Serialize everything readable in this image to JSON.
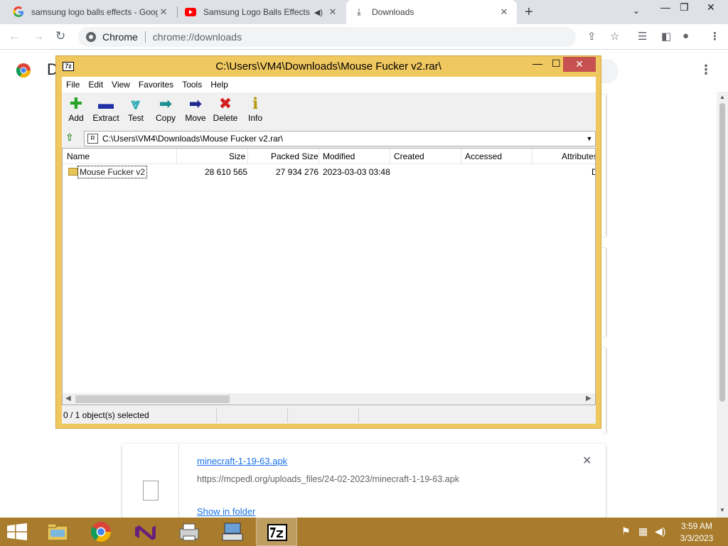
{
  "tabs": [
    {
      "title": "samsung logo balls effects - Google",
      "close": "✕"
    },
    {
      "title": "Samsung Logo Balls Effects (Inspire",
      "close": "✕"
    },
    {
      "title": "Downloads",
      "close": "✕"
    }
  ],
  "browser": {
    "new_tab": "+",
    "minimize": "—",
    "restore": "❐",
    "close": "✕",
    "back": "←",
    "forward": "→",
    "reload": "↻",
    "menu": "⋮",
    "address_label": "Chrome",
    "address_url": "chrome://downloads",
    "tab_search": "⌄"
  },
  "downloads_page": {
    "title_initial": "D",
    "menu": "⋮",
    "item": {
      "filename": "minecraft-1-19-63.apk",
      "url": "https://mcpedl.org/uploads_files/24-02-2023/minecraft-1-19-63.apk",
      "show_in_folder": "Show in folder",
      "remove": "✕"
    }
  },
  "sevenzip": {
    "title": "C:\\Users\\VM4\\Downloads\\Mouse Fucker v2.rar\\",
    "app_icon": "7z",
    "minimize": "—",
    "maximize": "☐",
    "close": "✕",
    "menu": [
      "File",
      "Edit",
      "View",
      "Favorites",
      "Tools",
      "Help"
    ],
    "toolbar": [
      {
        "label": "Add",
        "glyph": "✚",
        "color": "#27a327"
      },
      {
        "label": "Extract",
        "glyph": "▬",
        "color": "#1f2fa8"
      },
      {
        "label": "Test",
        "glyph": "⩔",
        "color": "#1fa7b0"
      },
      {
        "label": "Copy",
        "glyph": "➡",
        "color": "#1f8f8f"
      },
      {
        "label": "Move",
        "glyph": "➡",
        "color": "#1f2a8f"
      },
      {
        "label": "Delete",
        "glyph": "✖",
        "color": "#d21f1f"
      },
      {
        "label": "Info",
        "glyph": "ℹ",
        "color": "#b39a10"
      }
    ],
    "address_icon": "R",
    "address": "C:\\Users\\VM4\\Downloads\\Mouse Fucker v2.rar\\",
    "columns": [
      "Name",
      "Size",
      "Packed Size",
      "Modified",
      "Created",
      "Accessed",
      "Attributes"
    ],
    "rows": [
      {
        "name": "Mouse Fucker v2",
        "size": "28 610 565",
        "packed": "27 934 276",
        "modified": "2023-03-03 03:48",
        "created": "",
        "accessed": "",
        "attributes": "D"
      }
    ],
    "status": [
      "0 / 1 object(s) selected",
      "",
      "",
      ""
    ]
  },
  "taskbar": {
    "clock_time": "3:59 AM",
    "clock_date": "3/3/2023"
  }
}
